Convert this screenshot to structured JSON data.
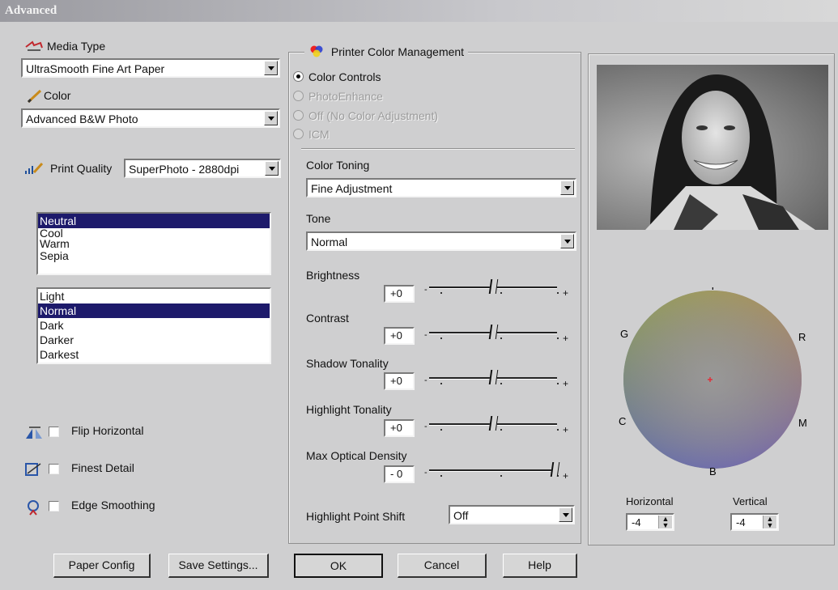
{
  "window": {
    "title": "Advanced"
  },
  "media_type": {
    "label": "Media Type",
    "value": "UltraSmooth Fine Art Paper"
  },
  "color": {
    "label": "Color",
    "value": "Advanced B&W Photo"
  },
  "print_quality": {
    "label": "Print Quality",
    "value": "SuperPhoto - 2880dpi"
  },
  "tone_list": {
    "items": [
      "Neutral",
      "Cool",
      "Warm",
      "Sepia"
    ],
    "selected": "Neutral"
  },
  "density_list": {
    "items": [
      "Light",
      "Normal",
      "Dark",
      "Darker",
      "Darkest"
    ],
    "selected": "Normal"
  },
  "options": {
    "flip_horizontal": "Flip Horizontal",
    "finest_detail": "Finest Detail",
    "edge_smoothing": "Edge Smoothing"
  },
  "color_management": {
    "title": "Printer Color Management",
    "options": [
      "Color Controls",
      "PhotoEnhance",
      "Off (No Color Adjustment)",
      "ICM"
    ],
    "selected": "Color Controls"
  },
  "color_toning": {
    "label": "Color Toning",
    "value": "Fine Adjustment"
  },
  "tone": {
    "label": "Tone",
    "value": "Normal"
  },
  "sliders": {
    "brightness": {
      "label": "Brightness",
      "value": "+0",
      "level": 0.5
    },
    "contrast": {
      "label": "Contrast",
      "value": "+0",
      "level": 0.5
    },
    "shadow_tonality": {
      "label": "Shadow Tonality",
      "value": "+0",
      "level": 0.5
    },
    "highlight_tonality": {
      "label": "Highlight Tonality",
      "value": "+0",
      "level": 0.5
    },
    "max_optical_density": {
      "label": "Max Optical Density",
      "value": "- 0",
      "level": 1.0
    }
  },
  "highlight_point_shift": {
    "label": "Highlight Point Shift",
    "value": "Off"
  },
  "color_wheel": {
    "labels": {
      "top": "Y",
      "left": "G",
      "right": "R",
      "bottom_left": "C",
      "bottom_right": "M",
      "bottom": "B"
    },
    "horizontal": {
      "label": "Horizontal",
      "value": "-4"
    },
    "vertical": {
      "label": "Vertical",
      "value": "-4"
    }
  },
  "buttons": {
    "paper_config": "Paper Config",
    "save_settings": "Save Settings...",
    "ok": "OK",
    "cancel": "Cancel",
    "help": "Help"
  }
}
